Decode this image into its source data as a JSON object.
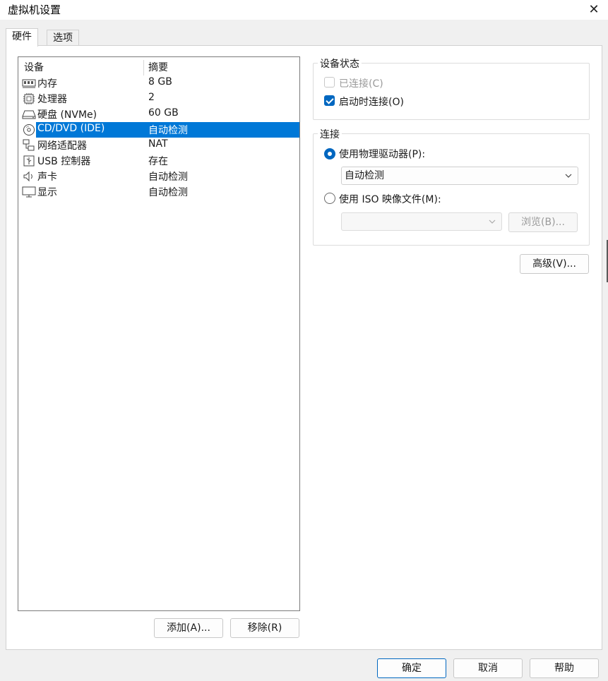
{
  "window": {
    "title": "虚拟机设置",
    "close_glyph": "✕"
  },
  "tabs": [
    {
      "label": "硬件",
      "active": true
    },
    {
      "label": "选项",
      "active": false
    }
  ],
  "device_list": {
    "columns": {
      "device": "设备",
      "summary": "摘要"
    },
    "rows": [
      {
        "icon": "memory-icon",
        "name": "内存",
        "summary": "8 GB",
        "selected": false
      },
      {
        "icon": "processor-icon",
        "name": "处理器",
        "summary": "2",
        "selected": false
      },
      {
        "icon": "hard-disk-icon",
        "name": "硬盘 (NVMe)",
        "summary": "60 GB",
        "selected": false
      },
      {
        "icon": "cd-dvd-icon",
        "name": "CD/DVD (IDE)",
        "summary": "自动检测",
        "selected": true
      },
      {
        "icon": "network-icon",
        "name": "网络适配器",
        "summary": "NAT",
        "selected": false
      },
      {
        "icon": "usb-icon",
        "name": "USB 控制器",
        "summary": "存在",
        "selected": false
      },
      {
        "icon": "sound-icon",
        "name": "声卡",
        "summary": "自动检测",
        "selected": false
      },
      {
        "icon": "display-icon",
        "name": "显示",
        "summary": "自动检测",
        "selected": false
      }
    ],
    "add_button": "添加(A)...",
    "remove_button": "移除(R)"
  },
  "device_status": {
    "legend": "设备状态",
    "connected": {
      "label": "已连接(C)",
      "checked": false,
      "disabled": true
    },
    "connect_on_start": {
      "label": "启动时连接(O)",
      "checked": true,
      "disabled": false
    }
  },
  "connection": {
    "legend": "连接",
    "physical": {
      "label": "使用物理驱动器(P):",
      "selected": true
    },
    "physical_drive_value": "自动检测",
    "iso": {
      "label": "使用 ISO 映像文件(M):",
      "selected": false
    },
    "iso_value": "",
    "browse_button": "浏览(B)..."
  },
  "advanced_button": "高级(V)...",
  "footer": {
    "ok": "确定",
    "cancel": "取消",
    "help": "帮助"
  },
  "colors": {
    "accent": "#0067c0",
    "selection": "#0078d7"
  }
}
